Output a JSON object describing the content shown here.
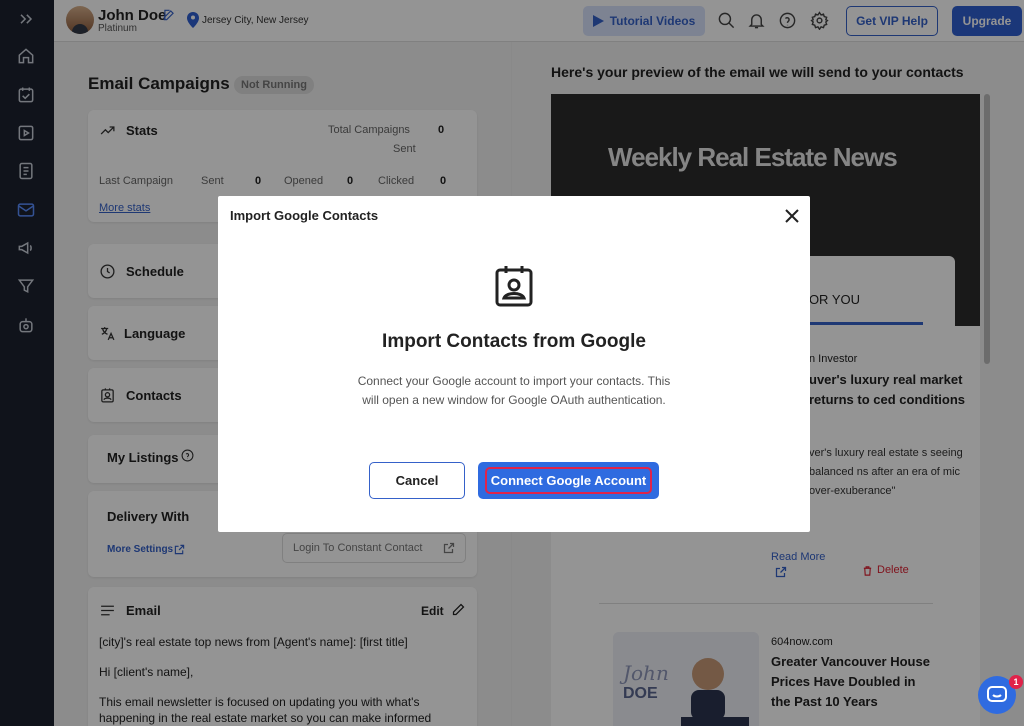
{
  "header": {
    "user_name": "John Doe",
    "user_tier": "Platinum",
    "location": "Jersey City, New Jersey",
    "tutorial_label": "Tutorial Videos",
    "vip_label": "Get VIP Help",
    "upgrade_label": "Upgrade"
  },
  "page": {
    "title": "Email Campaigns",
    "status": "Not Running"
  },
  "stats": {
    "title": "Stats",
    "total_campaigns_label": "Total Campaigns",
    "sent_label": "Sent",
    "total_campaigns_value": "0",
    "last_campaign_label": "Last Campaign",
    "sent_col_label": "Sent",
    "sent_value": "0",
    "opened_label": "Opened",
    "opened_value": "0",
    "clicked_label": "Clicked",
    "clicked_value": "0",
    "more_stats": "More stats"
  },
  "sections": {
    "schedule": "Schedule",
    "language": "Language",
    "contacts": "Contacts",
    "my_listings": "My Listings",
    "delivery_with": "Delivery With",
    "more_settings": "More Settings",
    "login_constant_contact": "Login To Constant Contact"
  },
  "email": {
    "title": "Email",
    "edit_label": "Edit",
    "line1": "[city]'s real estate top news from [Agent's name]: [first title]",
    "line2": "Hi [client's name],",
    "line3": "This email newsletter is focused on updating you with what's happening in the real estate market so you can make informed"
  },
  "preview": {
    "heading": "Here's your preview of the email we will send to your contacts",
    "banner": "Weekly Real Estate News",
    "tab": "FOR YOU",
    "article1_source": "n Investor",
    "article1_title": "uver's luxury real market returns to ced conditions",
    "article1_body": "ver's luxury real estate s seeing balanced ns after an era of mic over-exuberance\"",
    "read_more": "Read More",
    "delete": "Delete",
    "article2_source": "604now.com",
    "article2_title": "Greater Vancouver House Prices Have Doubled in the Past 10 Years"
  },
  "modal": {
    "header": "Import Google Contacts",
    "title": "Import Contacts from Google",
    "desc": "Connect your Google account to import your contacts. This will open a new window for Google OAuth authentication.",
    "cancel": "Cancel",
    "connect": "Connect Google Account"
  },
  "chat": {
    "badge": "1"
  },
  "colors": {
    "accent": "#2f5fd1",
    "sidebar": "#1c2230",
    "highlight": "#e0234a"
  }
}
